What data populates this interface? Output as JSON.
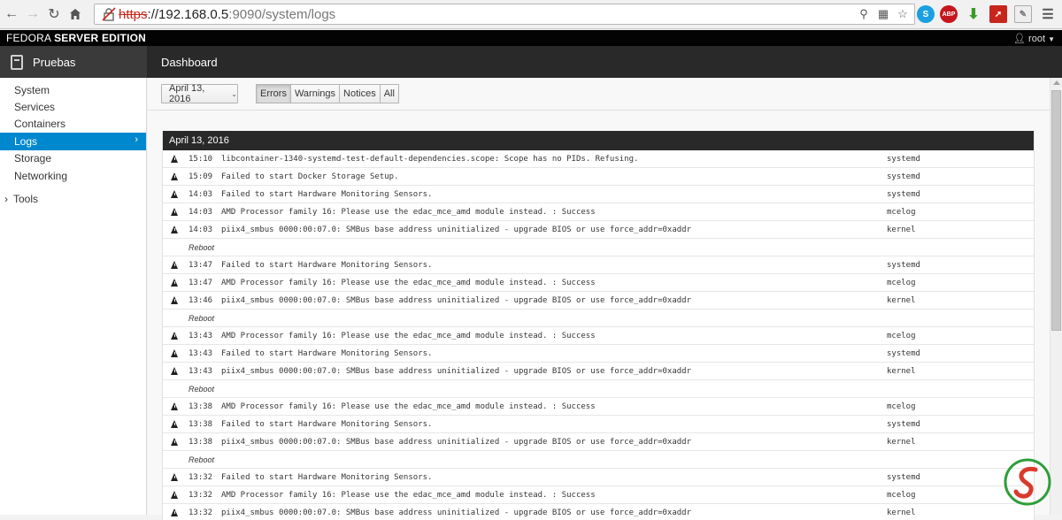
{
  "browser": {
    "url_scheme": "https",
    "url_host": "://192.168.0.5",
    "url_path": ":9090/system/logs"
  },
  "topbar": {
    "brand_light": "FEDORA ",
    "brand_bold": "SERVER EDITION",
    "user": "root"
  },
  "host": {
    "name": "Pruebas",
    "dashboard": "Dashboard"
  },
  "sidebar": {
    "items": [
      {
        "label": "System"
      },
      {
        "label": "Services"
      },
      {
        "label": "Containers"
      },
      {
        "label": "Logs"
      },
      {
        "label": "Storage"
      },
      {
        "label": "Networking"
      }
    ],
    "tools": "Tools"
  },
  "filters": {
    "date": "April 13, 2016",
    "priorities": [
      "Errors",
      "Warnings",
      "Notices",
      "All"
    ],
    "active_priority": "Errors"
  },
  "log": {
    "day": "April 13, 2016",
    "rows": [
      {
        "type": "entry",
        "time": "15:10",
        "message": "libcontainer-1340-systemd-test-default-dependencies.scope: Scope has no PIDs. Refusing.",
        "ident": "systemd"
      },
      {
        "type": "entry",
        "time": "15:09",
        "message": "Failed to start Docker Storage Setup.",
        "ident": "systemd"
      },
      {
        "type": "entry",
        "time": "14:03",
        "message": "Failed to start Hardware Monitoring Sensors.",
        "ident": "systemd"
      },
      {
        "type": "entry",
        "time": "14:03",
        "message": "AMD Processor family 16: Please use the edac_mce_amd module instead. : Success",
        "ident": "mcelog"
      },
      {
        "type": "entry",
        "time": "14:03",
        "message": "piix4_smbus 0000:00:07.0: SMBus base address uninitialized - upgrade BIOS or use force_addr=0xaddr",
        "ident": "kernel"
      },
      {
        "type": "reboot",
        "label": "Reboot"
      },
      {
        "type": "entry",
        "time": "13:47",
        "message": "Failed to start Hardware Monitoring Sensors.",
        "ident": "systemd"
      },
      {
        "type": "entry",
        "time": "13:47",
        "message": "AMD Processor family 16: Please use the edac_mce_amd module instead. : Success",
        "ident": "mcelog"
      },
      {
        "type": "entry",
        "time": "13:46",
        "message": "piix4_smbus 0000:00:07.0: SMBus base address uninitialized - upgrade BIOS or use force_addr=0xaddr",
        "ident": "kernel"
      },
      {
        "type": "reboot",
        "label": "Reboot"
      },
      {
        "type": "entry",
        "time": "13:43",
        "message": "AMD Processor family 16: Please use the edac_mce_amd module instead. : Success",
        "ident": "mcelog"
      },
      {
        "type": "entry",
        "time": "13:43",
        "message": "Failed to start Hardware Monitoring Sensors.",
        "ident": "systemd"
      },
      {
        "type": "entry",
        "time": "13:43",
        "message": "piix4_smbus 0000:00:07.0: SMBus base address uninitialized - upgrade BIOS or use force_addr=0xaddr",
        "ident": "kernel"
      },
      {
        "type": "reboot",
        "label": "Reboot"
      },
      {
        "type": "entry",
        "time": "13:38",
        "message": "AMD Processor family 16: Please use the edac_mce_amd module instead. : Success",
        "ident": "mcelog"
      },
      {
        "type": "entry",
        "time": "13:38",
        "message": "Failed to start Hardware Monitoring Sensors.",
        "ident": "systemd"
      },
      {
        "type": "entry",
        "time": "13:38",
        "message": "piix4_smbus 0000:00:07.0: SMBus base address uninitialized - upgrade BIOS or use force_addr=0xaddr",
        "ident": "kernel"
      },
      {
        "type": "reboot",
        "label": "Reboot"
      },
      {
        "type": "entry",
        "time": "13:32",
        "message": "Failed to start Hardware Monitoring Sensors.",
        "ident": "systemd"
      },
      {
        "type": "entry",
        "time": "13:32",
        "message": "AMD Processor family 16: Please use the edac_mce_amd module instead. : Success",
        "ident": "mcelog"
      },
      {
        "type": "entry",
        "time": "13:32",
        "message": "piix4_smbus 0000:00:07.0: SMBus base address uninitialized - upgrade BIOS or use force_addr=0xaddr",
        "ident": "kernel"
      }
    ]
  },
  "colors": {
    "accent": "#0088ce",
    "topbar": "#030303",
    "hostbar": "#292929"
  },
  "icons": [
    "back-icon",
    "forward-icon",
    "reload-icon",
    "home-icon",
    "insecure-lock-icon",
    "zoom-icon",
    "translate-icon",
    "bookmark-star-icon",
    "skype-icon",
    "adblock-icon",
    "download-icon",
    "pdf-icon",
    "notes-icon",
    "chrome-menu-icon",
    "user-icon",
    "host-icon",
    "warning-icon"
  ]
}
